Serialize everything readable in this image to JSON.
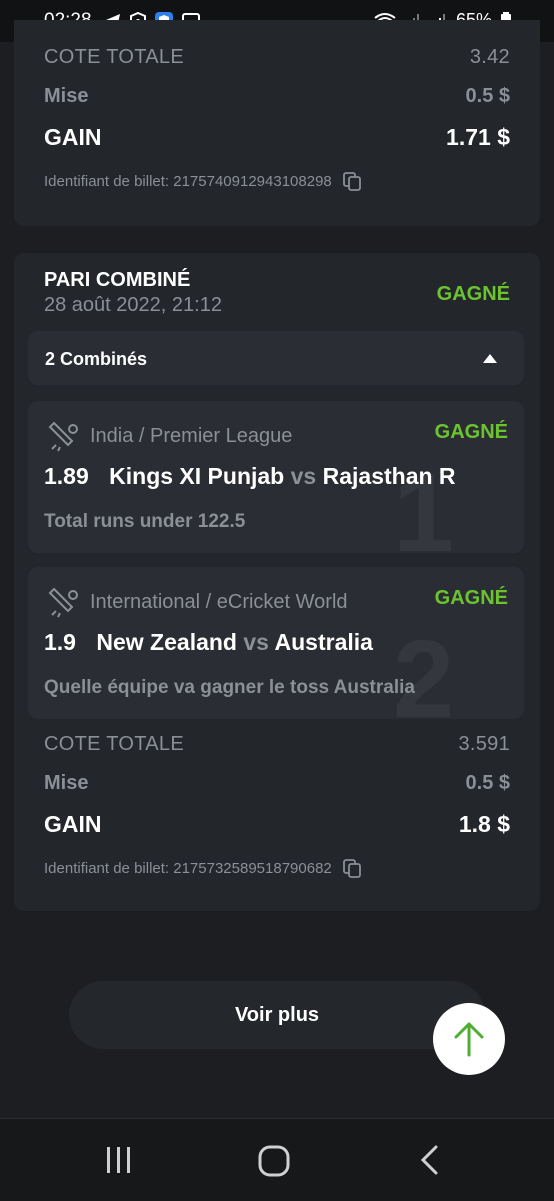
{
  "status_bar": {
    "time": "02:28",
    "battery": "65%"
  },
  "ticket1": {
    "cote_label": "COTE TOTALE",
    "cote_value": "3.42",
    "mise_label": "Mise",
    "mise_value": "0.5 $",
    "gain_label": "GAIN",
    "gain_value": "1.71 $",
    "ticket_id": "Identifiant de billet: 2175740912943108298"
  },
  "ticket2": {
    "type": "PARI COMBINÉ",
    "date": "28 août 2022, 21:12",
    "status": "GAGNÉ",
    "combos_label": "2 Combinés",
    "bets": [
      {
        "league": "India / Premier League",
        "status": "GAGNÉ",
        "odds": "1.89",
        "team1": "Kings XI Punjab",
        "vs": "vs",
        "team2": "Rajasthan R",
        "market": "Total runs under 122.5",
        "index": "1"
      },
      {
        "league": "International / eCricket World",
        "status": "GAGNÉ",
        "odds": "1.9",
        "team1": "New Zealand",
        "vs": "vs",
        "team2": "Australia",
        "market": "Quelle équipe va gagner le toss Australia",
        "index": "2"
      }
    ],
    "cote_label": "COTE TOTALE",
    "cote_value": "3.591",
    "mise_label": "Mise",
    "mise_value": "0.5 $",
    "gain_label": "GAIN",
    "gain_value": "1.8 $",
    "ticket_id": "Identifiant de billet: 2175732589518790682"
  },
  "voir_plus": "Voir plus",
  "colors": {
    "win": "#6cc330",
    "background": "#1c1e22",
    "card": "#23262b"
  },
  "icons": [
    "cricket-icon",
    "copy-icon",
    "chevron-up-icon",
    "arrow-up-icon"
  ]
}
